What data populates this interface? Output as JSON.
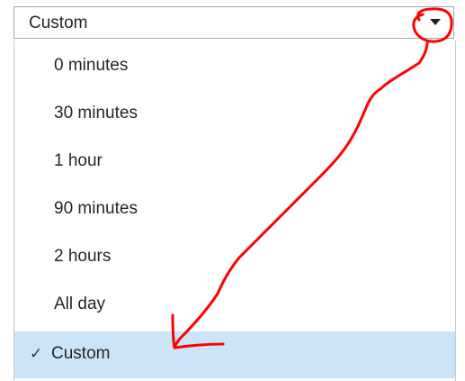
{
  "select": {
    "value": "Custom",
    "arrow_icon": "chevron-down-icon"
  },
  "dropdown": {
    "options": [
      {
        "label": "0 minutes",
        "selected": false
      },
      {
        "label": "30 minutes",
        "selected": false
      },
      {
        "label": "1 hour",
        "selected": false
      },
      {
        "label": "90 minutes",
        "selected": false
      },
      {
        "label": "2 hours",
        "selected": false
      },
      {
        "label": "All day",
        "selected": false
      },
      {
        "label": "Custom",
        "selected": true
      }
    ],
    "check_glyph": "✓",
    "selected_color": "#cce4f7"
  },
  "annotation": {
    "color": "#ff0000"
  }
}
